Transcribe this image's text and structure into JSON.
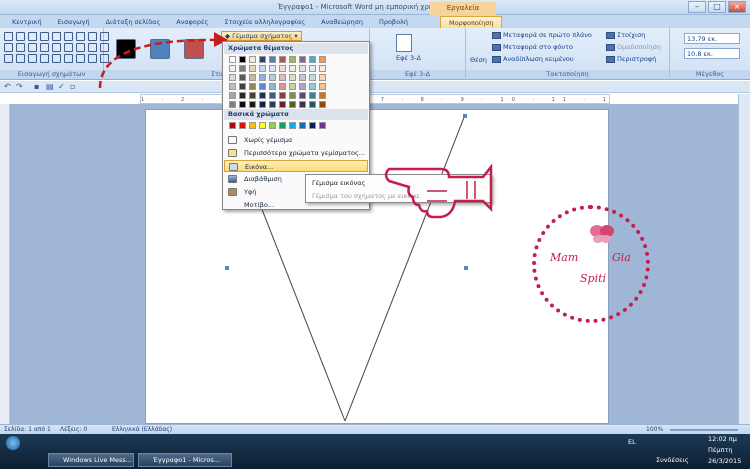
{
  "window": {
    "title": "Έγγραφο1 - Microsoft Word μη εμπορική χρήση",
    "context_tab_group": "Εργαλεία σχεδίασης"
  },
  "tabs": [
    "Κεντρική",
    "Εισαγωγή",
    "Διάταξη σελίδας",
    "Αναφορές",
    "Στοιχεία αλληλογραφίας",
    "Αναθεώρηση",
    "Προβολή",
    "Μορφοποίηση"
  ],
  "active_tab": "Μορφοποίηση",
  "ribbon": {
    "groups": [
      {
        "label": "Εισαγωγή σχημάτων"
      },
      {
        "label": "Στυλ σχημάτων"
      },
      {
        "label": "Εφέ 3-Δ"
      },
      {
        "label": "Τακτοποίηση"
      },
      {
        "label": "Μέγεθος"
      }
    ],
    "fill_button": "Γέμισμα σχήματος",
    "effects_3d": "Εφέ 3-Δ",
    "position": "Θέση",
    "bring_front": "Μεταφορά σε πρώτο πλάνο",
    "send_back": "Μεταφορά στο φόντο",
    "text_wrap": "Αναδίπλωση κειμένου",
    "align": "Στοίχιση",
    "group": "Ομαδοποίηση",
    "rotate": "Περιστροφή",
    "height": "13,79 εκ.",
    "width": "10,8 εκ.",
    "style_colors": [
      "#000000",
      "#4f81bd",
      "#c0504d"
    ]
  },
  "menu": {
    "theme_colors_header": "Χρώματα θέματος",
    "standard_colors_header": "Βασικά χρώματα",
    "theme_colors": [
      "#ffffff",
      "#000000",
      "#eeece1",
      "#1f497d",
      "#4f81bd",
      "#c0504d",
      "#9bbb59",
      "#8064a2",
      "#4bacc6",
      "#f79646"
    ],
    "theme_rows": [
      [
        "#f2f2f2",
        "#7f7f7f",
        "#ddd9c3",
        "#c6d9f0",
        "#dbe5f1",
        "#f2dcdb",
        "#ebf1dd",
        "#e5e0ec",
        "#dbeef3",
        "#fdeada"
      ],
      [
        "#d8d8d8",
        "#595959",
        "#c4bd97",
        "#8db3e2",
        "#b8cce4",
        "#e5b9b7",
        "#d7e3bc",
        "#ccc1d9",
        "#b7dde8",
        "#fbd5b5"
      ],
      [
        "#bfbfbf",
        "#3f3f3f",
        "#938953",
        "#548dd4",
        "#95b3d7",
        "#d99694",
        "#c3d69b",
        "#b2a2c7",
        "#92cddc",
        "#fac08f"
      ],
      [
        "#a5a5a5",
        "#262626",
        "#494429",
        "#17365d",
        "#366092",
        "#953734",
        "#76923c",
        "#5f497a",
        "#31859b",
        "#e36c09"
      ],
      [
        "#7f7f7f",
        "#0c0c0c",
        "#1d1b10",
        "#0f243e",
        "#244061",
        "#632423",
        "#4f6128",
        "#3f3151",
        "#205867",
        "#974806"
      ]
    ],
    "standard_colors": [
      "#c00000",
      "#ff0000",
      "#ffc000",
      "#ffff00",
      "#92d050",
      "#00b050",
      "#00b0f0",
      "#0070c0",
      "#002060",
      "#7030a0"
    ],
    "items": [
      "Χωρίς γέμισμα",
      "Περισσότερα χρώματα γεμίσματος...",
      "Εικόνα...",
      "Διαβάθμιση",
      "Υφή",
      "Μοτίβο..."
    ],
    "highlighted_item": "Εικόνα..."
  },
  "submenu": {
    "title": "Γέμισμα εικόνας",
    "description": "Γέμισμα του σχήματος με εικόνα."
  },
  "statusbar": {
    "page": "Σελίδα: 1 από 1",
    "words": "Λέξεις: 0",
    "language": "Ελληνικά (Ελλάδας)",
    "zoom": "100%"
  },
  "taskbar": {
    "buttons": [
      "Windows Live Mess...",
      "Έγγραφο1 - Micros..."
    ],
    "lang": "EL",
    "tray_label": "Συνδέσεις",
    "time": "12:02 πμ",
    "day": "Πέμπτη",
    "date": "26/3/2015"
  },
  "watermark": {
    "line1": "Mam",
    "line2": "Gia",
    "line3": "Spiti"
  },
  "colors": {
    "accent_red": "#c41e4b",
    "ribbon_blue": "#cfe0f4"
  }
}
